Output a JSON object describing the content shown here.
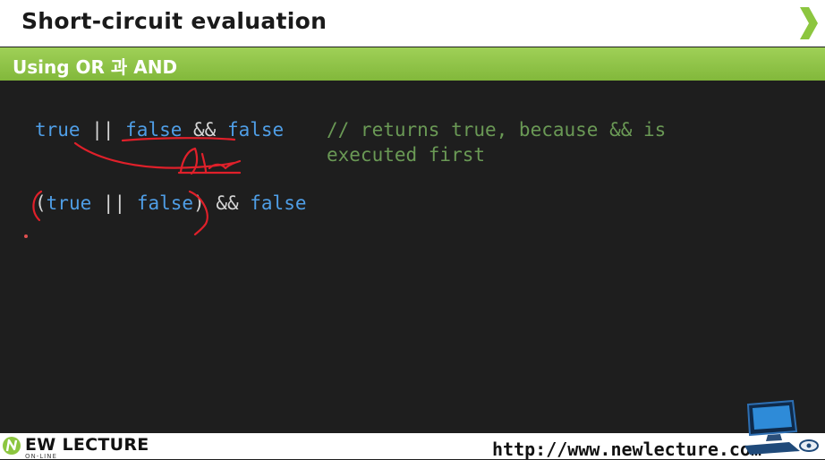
{
  "slide": {
    "title": "Short-circuit evaluation",
    "section": "Using OR 과 AND"
  },
  "code": {
    "line1": {
      "t1": "true",
      "op1": " || ",
      "t2": "false",
      "op2": " && ",
      "t3": "false"
    },
    "comment_line1": "// returns true, because && is",
    "comment_line2": "executed first",
    "line2": {
      "p1": "(",
      "t1": "true",
      "op1": " || ",
      "t2": "false",
      "p2": ")",
      "op2": " && ",
      "t3": "false"
    }
  },
  "footer": {
    "logo_text": "EW LECTURE",
    "logo_sub": "ON-LINE",
    "url": "http://www.newlecture.com"
  },
  "colors": {
    "accent_green": "#8cc63f",
    "keyword_blue": "#4f9ee6",
    "comment_green": "#6a9955",
    "annotation_red": "#e0202a"
  }
}
